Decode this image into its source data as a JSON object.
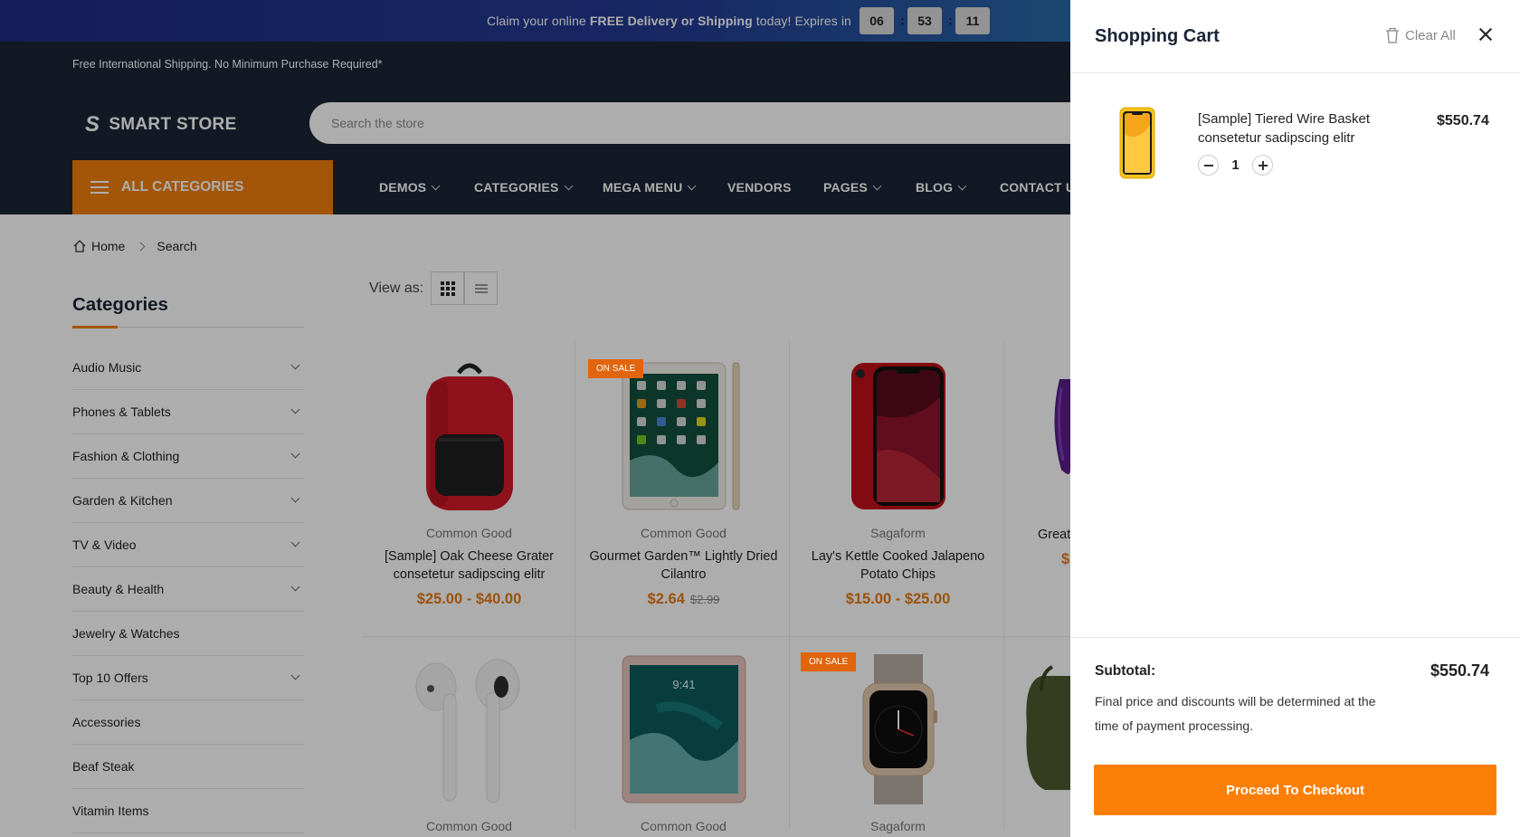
{
  "promo": {
    "text_before": "Claim your online ",
    "text_bold": "FREE Delivery or Shipping",
    "text_after": " today! Expires in",
    "hours": "06",
    "minutes": "53",
    "seconds": "11",
    "separator": ":"
  },
  "topbar": {
    "text": "Free International Shipping. No Minimum Purchase Required*"
  },
  "header": {
    "logo_mark": "S",
    "logo_text": "SMART STORE",
    "search_placeholder": "Search the store"
  },
  "nav": {
    "all_categories": "ALL CATEGORIES",
    "items": [
      "DEMOS",
      "CATEGORIES",
      "MEGA MENU",
      "VENDORS",
      "PAGES",
      "BLOG",
      "CONTACT U"
    ]
  },
  "breadcrumb": {
    "home": "Home",
    "current": "Search"
  },
  "sidebar": {
    "title": "Categories",
    "items": [
      {
        "label": "Audio Music",
        "has_children": true
      },
      {
        "label": "Phones & Tablets",
        "has_children": true
      },
      {
        "label": "Fashion & Clothing",
        "has_children": true
      },
      {
        "label": "Garden & Kitchen",
        "has_children": true
      },
      {
        "label": "TV & Video",
        "has_children": true
      },
      {
        "label": "Beauty & Health",
        "has_children": true
      },
      {
        "label": "Jewelry & Watches",
        "has_children": false
      },
      {
        "label": "Top 10 Offers",
        "has_children": true
      },
      {
        "label": "Accessories",
        "has_children": false
      },
      {
        "label": "Beaf Steak",
        "has_children": false
      },
      {
        "label": "Vitamin Items",
        "has_children": false
      }
    ]
  },
  "view_as": {
    "label": "View as:"
  },
  "products": [
    {
      "brand": "Common Good",
      "name": "[Sample] Oak Cheese Grater consetetur sadipscing elitr",
      "price": "$25.00 - $40.00",
      "old_price": "",
      "badge": "",
      "image": "backpack"
    },
    {
      "brand": "Common Good",
      "name": "Gourmet Garden™ Lightly Dried Cilantro",
      "price": "$2.64",
      "old_price": "$2.99",
      "badge": "ON SALE",
      "image": "tablet"
    },
    {
      "brand": "Sagaform",
      "name": "Lay's Kettle Cooked Jalapeno Potato Chips",
      "price": "$15.00 - $25.00",
      "old_price": "",
      "badge": "",
      "image": "phone-red"
    },
    {
      "brand": "",
      "name": "Great",
      "price": "$",
      "old_price": "",
      "badge": "",
      "image": "purple-item"
    },
    {
      "brand": "Common Good",
      "name": "",
      "price": "",
      "old_price": "",
      "badge": "",
      "image": "earbuds"
    },
    {
      "brand": "Common Good",
      "name": "",
      "price": "",
      "old_price": "",
      "badge": "",
      "image": "ipad-pro"
    },
    {
      "brand": "Sagaform",
      "name": "",
      "price": "",
      "old_price": "",
      "badge": "ON SALE",
      "image": "watch"
    },
    {
      "brand": "",
      "name": "",
      "price": "",
      "old_price": "",
      "badge": "",
      "image": "speaker"
    }
  ],
  "cart": {
    "title": "Shopping Cart",
    "clear_all": "Clear All",
    "items": [
      {
        "name": "[Sample] Tiered Wire Basket consetetur sadipscing elitr",
        "price": "$550.74",
        "qty": "1",
        "image": "phone-yellow"
      }
    ],
    "subtotal_label": "Subtotal:",
    "subtotal_value": "$550.74",
    "note": "Final price and discounts will be determined at the time of payment processing.",
    "checkout_label": "Proceed To Checkout"
  },
  "colors": {
    "accent": "#f07e0c",
    "navy": "#1b2535",
    "checkout": "#fb7f07",
    "price": "#e67a10"
  },
  "icons": [
    "home-icon",
    "trash-icon",
    "close-icon",
    "grid-view-icon",
    "list-view-icon",
    "hamburger-icon",
    "chevron-down-icon"
  ]
}
